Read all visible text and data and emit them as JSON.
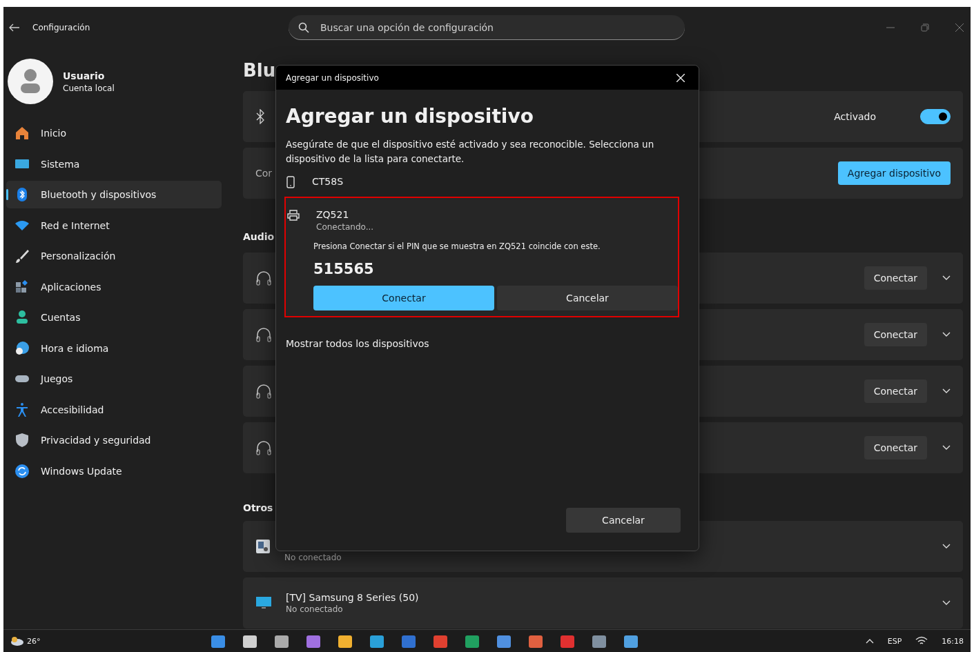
{
  "window": {
    "title": "Configuración"
  },
  "search": {
    "placeholder": "Buscar una opción de configuración"
  },
  "user": {
    "name": "Usuario",
    "account": "Cuenta local"
  },
  "sidebar": {
    "items": [
      {
        "label": "Inicio",
        "kind": "home",
        "selected": false
      },
      {
        "label": "Sistema",
        "kind": "system",
        "selected": false
      },
      {
        "label": "Bluetooth y dispositivos",
        "kind": "bluetooth",
        "selected": true
      },
      {
        "label": "Red e Internet",
        "kind": "wifi",
        "selected": false
      },
      {
        "label": "Personalización",
        "kind": "brush",
        "selected": false
      },
      {
        "label": "Aplicaciones",
        "kind": "apps",
        "selected": false
      },
      {
        "label": "Cuentas",
        "kind": "person",
        "selected": false
      },
      {
        "label": "Hora e idioma",
        "kind": "globe",
        "selected": false
      },
      {
        "label": "Juegos",
        "kind": "gamepad",
        "selected": false
      },
      {
        "label": "Accesibilidad",
        "kind": "access",
        "selected": false
      },
      {
        "label": "Privacidad y seguridad",
        "kind": "shield",
        "selected": false
      },
      {
        "label": "Windows Update",
        "kind": "update",
        "selected": false
      }
    ]
  },
  "page_title": "Blu",
  "bluetooth_card": {
    "status": "Activado",
    "on": true
  },
  "add_card": {
    "label": "Cor",
    "button": "Agregar dispositivo"
  },
  "audio": {
    "heading": "Audio",
    "devices": [
      {
        "button": "Conectar"
      },
      {
        "button": "Conectar"
      },
      {
        "button": "Conectar"
      },
      {
        "button": "Conectar"
      }
    ]
  },
  "others": {
    "heading": "Otros",
    "devices": [
      {
        "kind": "media",
        "status": "No conectado"
      },
      {
        "kind": "tv",
        "name": "[TV] Samsung 8 Series (50)",
        "status": "No conectado"
      }
    ]
  },
  "dialog": {
    "title_bar": "Agregar un dispositivo",
    "heading": "Agregar un dispositivo",
    "description": "Asegúrate de que el dispositivo esté activado y sea reconocible. Selecciona un dispositivo de la lista para conectarte.",
    "devices": [
      {
        "kind": "phone",
        "name": "CT58S",
        "expanded": false
      },
      {
        "kind": "printer",
        "name": "ZQ521",
        "expanded": true,
        "status": "Conectando...",
        "prompt": "Presiona Conectar si el PIN que se muestra en ZQ521 coincide con este.",
        "pin": "515565",
        "actions": [
          {
            "label": "Conectar",
            "primary": true
          },
          {
            "label": "Cancelar",
            "primary": false
          }
        ]
      }
    ],
    "show_all": "Mostrar todos los dispositivos",
    "footer_button": "Cancelar"
  },
  "taskbar": {
    "weather": "26°",
    "language": "ESP",
    "time": "16:18"
  }
}
